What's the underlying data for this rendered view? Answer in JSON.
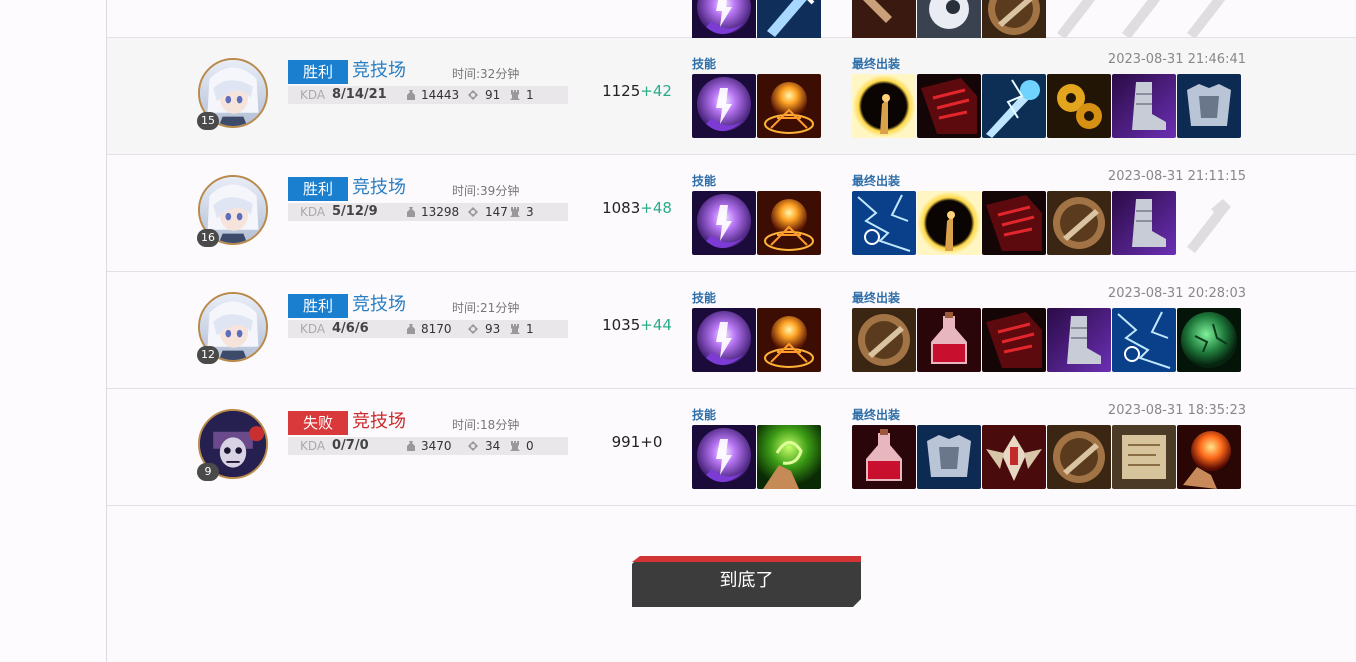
{
  "colors": {
    "win": "#1a7fcf",
    "lose": "#d9393a",
    "mode_win": "#2a7fc4",
    "mode_lose": "#cc2a2a",
    "score_plus": "#2aab8a",
    "label": "#2d6ea8",
    "bottom_button": "#3c3c3c",
    "bottom_bar": "#d23334"
  },
  "labels": {
    "kda": "KDA",
    "skills": "技能",
    "items": "最终出装"
  },
  "matches": [
    {
      "level": "15",
      "result": "胜利",
      "win": true,
      "mode": "竞技场",
      "time": "时间:32分钟",
      "kda": "8/14/21",
      "gold": "14443",
      "cs": "91",
      "towers": "1",
      "score": "1125",
      "delta": "+42",
      "date": "2023-08-31 21:46:41",
      "hero_icon": "silver-hair-hero-portrait",
      "skills": [
        "purple-flash-skill-icon",
        "ignite-skill-icon"
      ],
      "items": [
        "dark-orb-item-icon",
        "red-book-item-icon",
        "lightning-wand-item-icon",
        "gears-item-icon",
        "boots-item-icon",
        "armor-item-icon"
      ]
    },
    {
      "level": "16",
      "result": "胜利",
      "win": true,
      "mode": "竞技场",
      "time": "时间:39分钟",
      "kda": "5/12/9",
      "gold": "13298",
      "cs": "147",
      "towers": "3",
      "score": "1083",
      "delta": "+48",
      "date": "2023-08-31 21:11:15",
      "hero_icon": "silver-hair-hero-portrait",
      "skills": [
        "purple-flash-skill-icon",
        "ignite-skill-icon"
      ],
      "items": [
        "blue-lightning-item-icon",
        "dark-orb-item-icon",
        "red-book-item-icon",
        "bronze-shield-item-icon",
        "boots-item-icon",
        "empty-slot-icon"
      ]
    },
    {
      "level": "12",
      "result": "胜利",
      "win": true,
      "mode": "竞技场",
      "time": "时间:21分钟",
      "kda": "4/6/6",
      "gold": "8170",
      "cs": "93",
      "towers": "1",
      "score": "1035",
      "delta": "+44",
      "date": "2023-08-31 20:28:03",
      "hero_icon": "silver-hair-hero-portrait",
      "skills": [
        "purple-flash-skill-icon",
        "ignite-skill-icon"
      ],
      "items": [
        "bronze-shield-item-icon",
        "red-potion-item-icon",
        "red-book-item-icon",
        "boots-item-icon",
        "blue-lightning-item-icon",
        "green-orb-item-icon"
      ]
    },
    {
      "level": "9",
      "result": "失败",
      "win": false,
      "mode": "竞技场",
      "time": "时间:18分钟",
      "kda": "0/7/0",
      "gold": "3470",
      "cs": "34",
      "towers": "0",
      "score": "991",
      "delta": "+0",
      "date": "2023-08-31 18:35:23",
      "hero_icon": "skull-hero-portrait",
      "skills": [
        "purple-flash-skill-icon",
        "green-hand-skill-icon"
      ],
      "items": [
        "red-potion-item-icon",
        "armor-item-icon",
        "winged-emblem-item-icon",
        "bronze-shield-item-icon",
        "scroll-item-icon",
        "fire-orb-item-icon"
      ]
    }
  ],
  "top_partial": {
    "skills": [
      "purple-flash-skill-icon",
      "blue-sword-skill-icon"
    ],
    "items": [
      "axe-item-icon",
      "eye-item-icon",
      "bronze-shield-item-icon",
      "empty-slot-icon",
      "empty-slot-icon",
      "empty-slot-icon"
    ]
  },
  "bottom_button": "到底了"
}
